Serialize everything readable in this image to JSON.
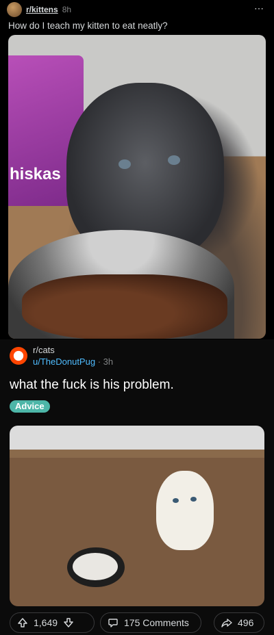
{
  "post1": {
    "subreddit": "r/kittens",
    "age": "8h",
    "more": "⋯",
    "title": "How do I teach my kitten to eat neatly?",
    "image_text": "hiskas"
  },
  "post2": {
    "subreddit": "r/cats",
    "user": "u/TheDonutPug",
    "sep": "·",
    "age": "3h",
    "title": "what the fuck is his problem.",
    "flair": "Advice",
    "votes": "1,649",
    "comments": "175 Comments",
    "shares": "496"
  },
  "colors": {
    "background": "#000000",
    "username": "#4fbcff",
    "flair": "#4db6a8"
  }
}
